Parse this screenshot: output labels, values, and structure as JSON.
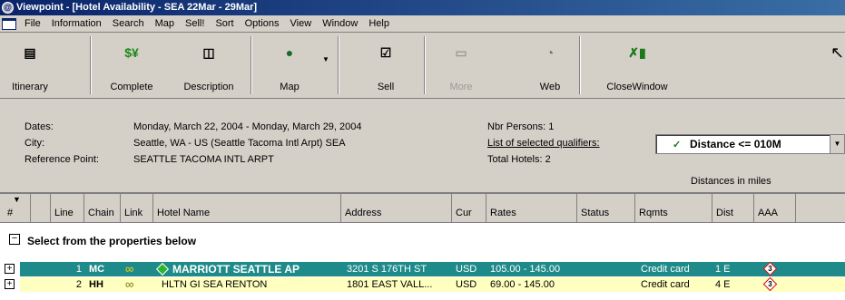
{
  "window": {
    "title": "Viewpoint - [Hotel Availability - SEA 22Mar - 29Mar]"
  },
  "menu": [
    "File",
    "Information",
    "Search",
    "Map",
    "Sell!",
    "Sort",
    "Options",
    "View",
    "Window",
    "Help"
  ],
  "toolbar": {
    "itinerary": "Itinerary",
    "complete": "Complete",
    "description": "Description",
    "map": "Map",
    "sell": "Sell",
    "more": "More",
    "web": "Web",
    "close_window": "CloseWindow"
  },
  "info": {
    "dates_label": "Dates:",
    "dates_value": "Monday, March 22, 2004 - Monday, March 29, 2004",
    "city_label": "City:",
    "city_value": "Seattle, WA - US (Seattle Tacoma Intl Arpt)  SEA",
    "ref_label": "Reference Point:",
    "ref_value": "SEATTLE TACOMA INTL ARPT",
    "persons": "Nbr Persons:   1",
    "qualifiers_label": "List of selected qualifiers:",
    "total_hotels": "Total Hotels: 2",
    "qualifier_selected": "Distance <= 010M",
    "distances_note": "Distances in miles"
  },
  "columns": {
    "num": "#",
    "line": "Line",
    "chain": "Chain",
    "link": "Link",
    "hotel_name": "Hotel Name",
    "address": "Address",
    "cur": "Cur",
    "rates": "Rates",
    "status": "Status",
    "rqmts": "Rqmts",
    "dist": "Dist",
    "aaa": "AAA"
  },
  "group": {
    "title": "Select from the properties below"
  },
  "rows": [
    {
      "line": "1",
      "chain": "MC",
      "hotel_name": "MARRIOTT SEATTLE AP",
      "address": "3201 S 176TH ST",
      "cur": "USD",
      "rates": "105.00 - 145.00",
      "rqmts": "Credit card",
      "dist": "1 E",
      "aaa": "3"
    },
    {
      "line": "2",
      "chain": "HH",
      "hotel_name": "HLTN GI SEA RENTON",
      "address": "1801 EAST VALL...",
      "cur": "USD",
      "rates": "69.00 - 145.00",
      "rqmts": "Credit card",
      "dist": "4 E",
      "aaa": "3"
    }
  ],
  "colors": {
    "selected_row": "#1f8a8a",
    "alt_row": "#ffffc0",
    "title_bar": "#0a246a"
  }
}
